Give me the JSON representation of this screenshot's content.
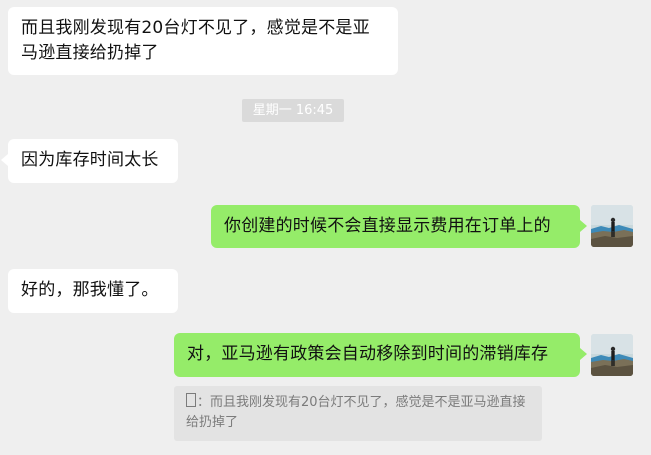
{
  "messages": [
    {
      "direction": "in",
      "text": "而且我刚发现有20台灯不见了，感觉是不是亚马逊直接给扔掉了"
    },
    {
      "direction": "in",
      "text": "因为库存时间太长"
    },
    {
      "direction": "out",
      "text": "你创建的时候不会直接显示费用在订单上的"
    },
    {
      "direction": "in",
      "text": "好的，那我懂了。"
    },
    {
      "direction": "out",
      "text": "对，亚马逊有政策会自动移除到时间的滞销库存"
    }
  ],
  "timestamp": "星期一 16:45",
  "quote": {
    "prefix": "：",
    "text": "而且我刚发现有20台灯不见了，感觉是不是亚马逊直接给扔掉了"
  },
  "colors": {
    "background": "#efefef",
    "incoming_bubble": "#ffffff",
    "outgoing_bubble": "#95ec69",
    "timestamp_bg": "#dadada",
    "quote_bg": "#e3e3e3"
  },
  "icons": [
    "avatar-image",
    "tofu-glyph"
  ]
}
